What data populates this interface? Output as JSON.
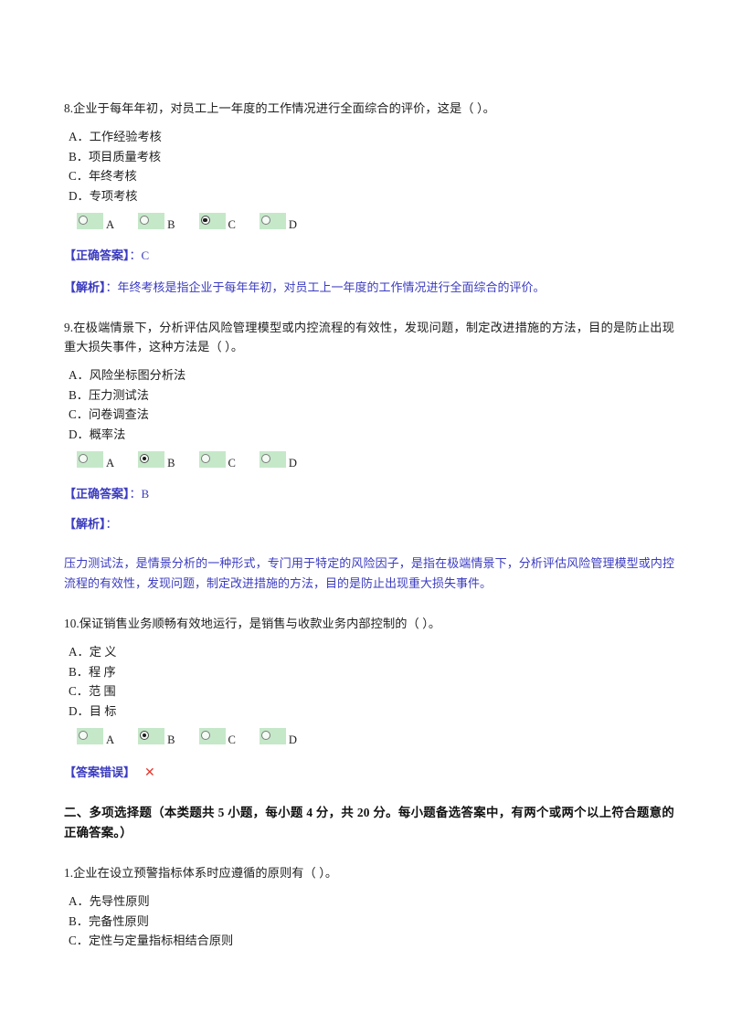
{
  "document": {
    "kind": "exam-answer-sheet"
  },
  "colors": {
    "answer_blue": "#3b3bc0",
    "radio_background_green": "#c5e8c9",
    "wrong_mark_red": "#e03a2f",
    "body_text": "#202020"
  },
  "questions": [
    {
      "number": "8.",
      "stem": "8.企业于每年年初，对员工上一年度的工作情况进行全面综合的评价，这是（ ）。",
      "options": [
        {
          "letter": "A．",
          "text": "工作经验考核"
        },
        {
          "letter": "B．",
          "text": "项目质量考核"
        },
        {
          "letter": "C．",
          "text": "年终考核"
        },
        {
          "letter": "D．",
          "text": "专项考核"
        }
      ],
      "choices": [
        {
          "label": "A",
          "checked": false
        },
        {
          "label": "B",
          "checked": false
        },
        {
          "label": "C",
          "checked": true
        },
        {
          "label": "D",
          "checked": false
        }
      ],
      "answer_tag": "【正确答案】",
      "answer_sep": "：",
      "answer_value": "C",
      "analysis_tag": "【解析】",
      "analysis_sep": "：",
      "analysis_text": "年终考核是指企业于每年年初，对员工上一年度的工作情况进行全面综合的评价。"
    },
    {
      "number": "9.",
      "stem": "9.在极端情景下，分析评估风险管理模型或内控流程的有效性，发现问题，制定改进措施的方法，目的是防止出现重大损失事件，这种方法是（ ）。",
      "options": [
        {
          "letter": "A．",
          "text": "风险坐标图分析法"
        },
        {
          "letter": "B．",
          "text": "压力测试法"
        },
        {
          "letter": "C．",
          "text": "问卷调查法"
        },
        {
          "letter": "D．",
          "text": "概率法"
        }
      ],
      "choices": [
        {
          "label": "A",
          "checked": false
        },
        {
          "label": "B",
          "checked": true
        },
        {
          "label": "C",
          "checked": false
        },
        {
          "label": "D",
          "checked": false
        }
      ],
      "answer_tag": "【正确答案】",
      "answer_sep": "：",
      "answer_value": "B",
      "analysis_tag": "【解析】",
      "analysis_sep": "：",
      "analysis_text": "压力测试法，是情景分析的一种形式，专门用于特定的风险因子，是指在极端情景下，分析评估风险管理模型或内控流程的有效性，发现问题，制定改进措施的方法，目的是防止出现重大损失事件。"
    },
    {
      "number": "10.",
      "stem": "10.保证销售业务顺畅有效地运行，是销售与收款业务内部控制的（ ）。",
      "options": [
        {
          "letter": "A．",
          "text": "定  义"
        },
        {
          "letter": "B．",
          "text": "程  序"
        },
        {
          "letter": "C．",
          "text": "范  围"
        },
        {
          "letter": "D．",
          "text": "目  标"
        }
      ],
      "choices": [
        {
          "label": "A",
          "checked": false
        },
        {
          "label": "B",
          "checked": true
        },
        {
          "label": "C",
          "checked": false
        },
        {
          "label": "D",
          "checked": false
        }
      ],
      "wrong_tag": "【答案错误】",
      "wrong_mark": "✕"
    }
  ],
  "section_two": {
    "heading": "二、多项选择题（本类题共 5 小题，每小题 4 分，共 20 分。每小题备选答案中，有两个或两个以上符合题意的正确答案。）",
    "question": {
      "number": "1.",
      "stem": "1.企业在设立预警指标体系时应遵循的原则有（ ）。",
      "options": [
        {
          "letter": "A．",
          "text": "先导性原则"
        },
        {
          "letter": "B．",
          "text": "完备性原则"
        },
        {
          "letter": "C．",
          "text": "定性与定量指标相结合原则"
        }
      ]
    }
  }
}
